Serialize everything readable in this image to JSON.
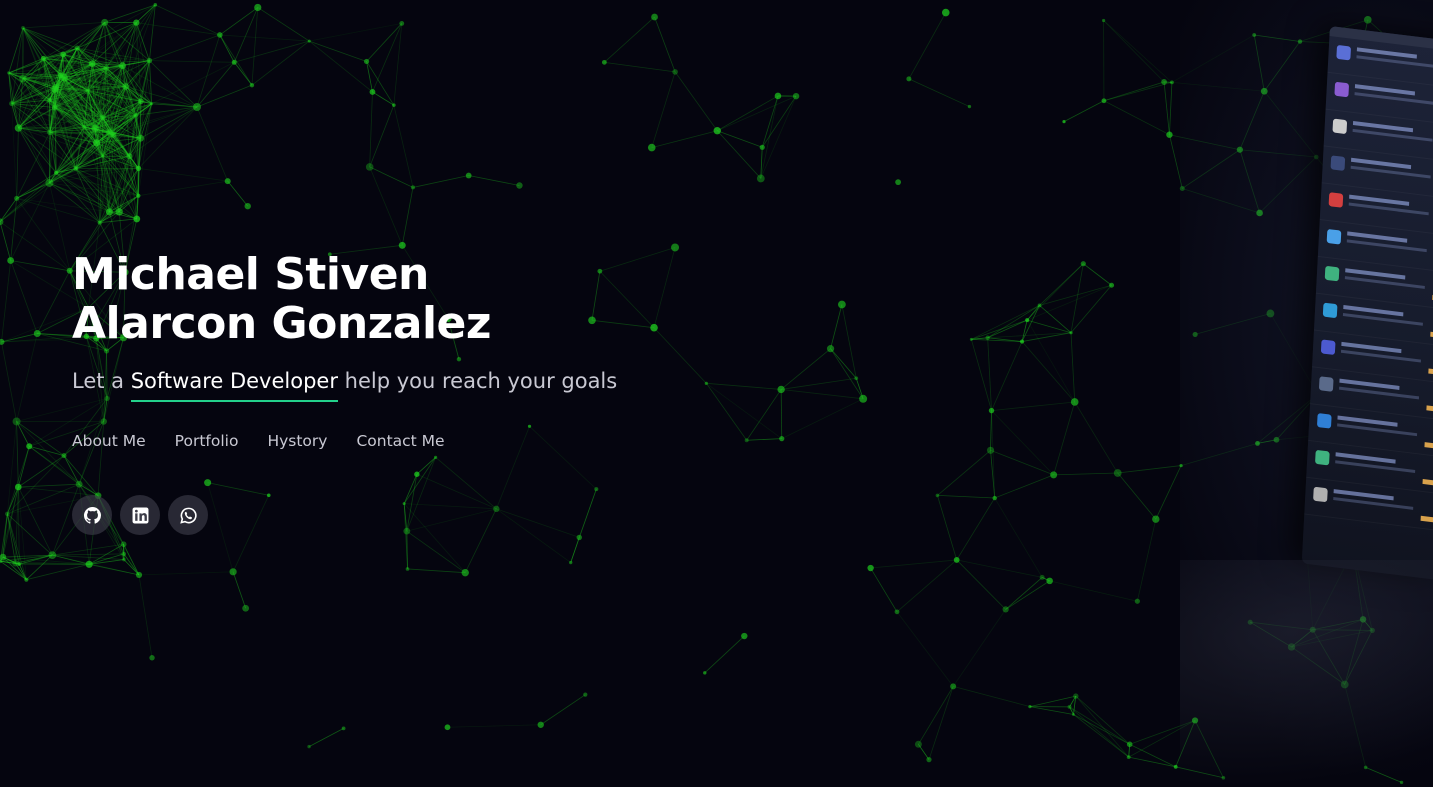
{
  "hero": {
    "name_line1": "Michael Stiven",
    "name_line2": "Alarcon Gonzalez",
    "tagline_prefix": "Let a",
    "tagline_highlight": "Software Developer",
    "tagline_suffix": "help you reach your goals"
  },
  "nav": {
    "items": [
      {
        "label": "About Me"
      },
      {
        "label": "Portfolio"
      },
      {
        "label": "Hystory"
      },
      {
        "label": "Contact Me"
      }
    ]
  },
  "socials": [
    {
      "icon": "github-icon"
    },
    {
      "icon": "linkedin-icon"
    },
    {
      "icon": "whatsapp-icon"
    }
  ],
  "colors": {
    "background": "#05050f",
    "network": "#1fd21f",
    "accent_underline": "#23d18b",
    "text_muted": "#c9c9d3"
  }
}
